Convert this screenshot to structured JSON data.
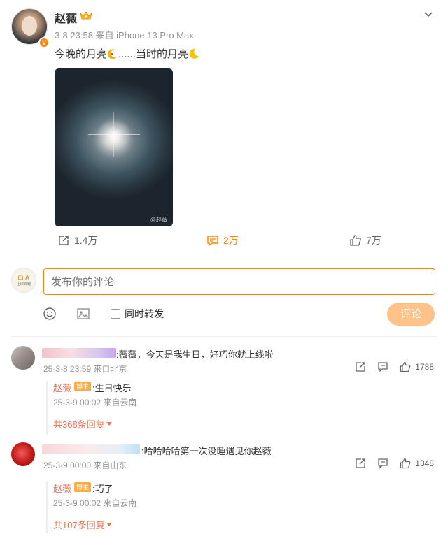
{
  "post": {
    "author": "赵薇",
    "time_source": "3-8 23:58 来自 iPhone 13 Pro Max",
    "text_part1": "今晚的月亮",
    "text_part2": "......当时的月亮",
    "image_watermark": "@赵薇",
    "reposts": "1.4万",
    "comments": "2万",
    "likes": "7万"
  },
  "composer": {
    "avatar_label_top": "ᗝ A",
    "avatar_label_bottom": "上岸锦鲤",
    "placeholder": "发布你的评论",
    "forward_label": "同时转发",
    "submit_label": "评论"
  },
  "comments": [
    {
      "text": ":薇薇，今天是我生日，好巧你就上线啦",
      "meta": "25-3-8 23:59 来自北京",
      "likes": "1788",
      "reply": {
        "author": "赵薇",
        "badge": "博主",
        "text": ":生日快乐",
        "meta": "25-3-9 00:02 来自云南",
        "more": "共368条回复"
      }
    },
    {
      "text": ":哈哈哈哈第一次没睡遇见你赵薇",
      "meta": "25-3-9 00:00 来自山东",
      "likes": "1348",
      "reply": {
        "author": "赵薇",
        "badge": "博主",
        "text": ":巧了",
        "meta": "25-3-9 00:02 来自云南",
        "more": "共107条回复"
      }
    }
  ],
  "colors": {
    "brand_orange": "#ff8200",
    "reply_name": "#eb7350",
    "submit_disabled": "#ffc38a",
    "meta_gray": "#939393"
  },
  "icons": [
    "crown-icon",
    "chevron-down-icon",
    "moon-emoji-icon",
    "repost-icon",
    "comment-icon",
    "like-icon",
    "smiley-icon",
    "image-icon",
    "reply-icon"
  ]
}
